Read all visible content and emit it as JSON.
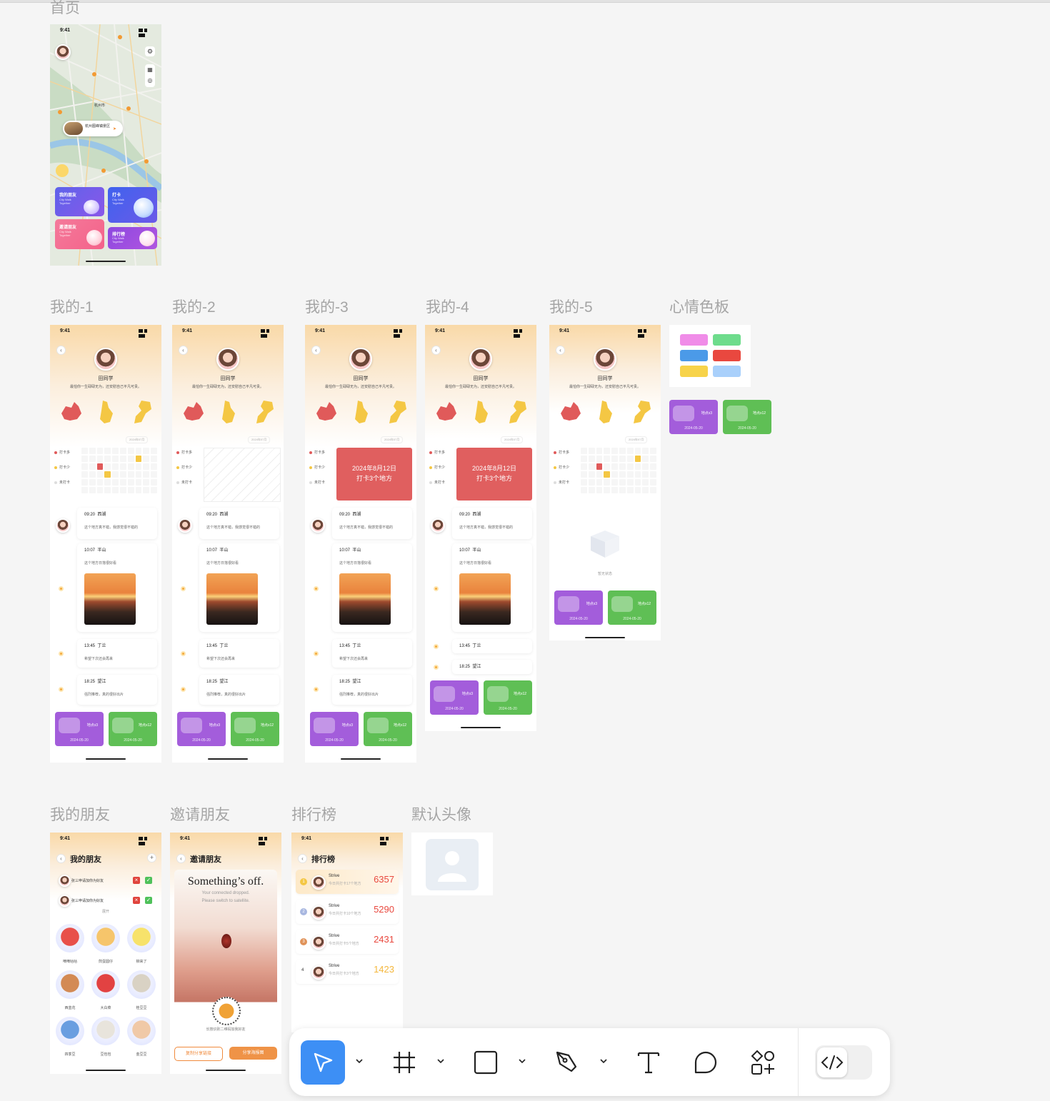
{
  "sections": {
    "home": "首页",
    "me1": "我的-1",
    "me2": "我的-2",
    "me3": "我的-3",
    "me4": "我的-4",
    "me5": "我的-5",
    "mood": "心情色板",
    "friends": "我的朋友",
    "invite": "邀请朋友",
    "rank": "排行榜",
    "default_avatar": "默认头像"
  },
  "status_time": "9:41",
  "home": {
    "city_label": "杭州市",
    "place_label": "杭州图峰镇景区",
    "cards": [
      {
        "title": "我的朋友",
        "sub": "City Walk Together",
        "color": "#6a55e6"
      },
      {
        "title": "打卡",
        "sub": "City Walk Together",
        "color": "#4e6cf0"
      },
      {
        "title": "邀请朋友",
        "sub": "City Walk Together",
        "color": "#f26a8e"
      },
      {
        "title": "排行榜",
        "sub": "City Walk Together",
        "color": "#8a45d9"
      }
    ]
  },
  "profile": {
    "name": "田同学",
    "motto": "最怕你一生碌碌无为，还安慰自己平凡可贵。",
    "date_pill": "2024年07月",
    "legend": [
      "打卡多",
      "打卡少",
      "未打卡"
    ],
    "summary": "2024年8月12日\n打卡3个地方",
    "summary_line1": "2024年8月12日",
    "summary_line2": "打卡3个地方",
    "timeline": [
      {
        "time": "09:20",
        "place": "西湖",
        "text": "这个地方真不错，我感觉很不错的"
      },
      {
        "time": "10:07",
        "place": "半山",
        "text": "这个地方日落很好看"
      },
      {
        "time": "13:45",
        "place": "丁兰",
        "text": "希望下次还会再来"
      },
      {
        "time": "18:25",
        "place": "望江",
        "text": "强烈推荐，真的很好出片"
      }
    ],
    "badges": [
      {
        "label": "地点x3",
        "date": "2024-05-20"
      },
      {
        "label": "地点x12",
        "date": "2024-05-20"
      }
    ],
    "empty_state": "暂无状态"
  },
  "mood_colors": [
    "#f08ce8",
    "#6edc8c",
    "#4b9ae8",
    "#e9483f",
    "#f7d34a",
    "#a9d0fb"
  ],
  "friends": {
    "title": "我的朋友",
    "requests": [
      "张三申请加你为好友",
      "张三申请加你为好友"
    ],
    "expand": "展开",
    "list": [
      "嘀嘀咕咕",
      "煎蛋圆仔",
      "柳来了",
      "西蓝花",
      "大白菜",
      "桂豆豆",
      "四季豆",
      "豆包包",
      "金豆豆"
    ]
  },
  "invite": {
    "title": "邀请朋友",
    "error_title": "Something’s off.",
    "error_sub1": "Your connected dropped.",
    "error_sub2": "Please switch to satellite.",
    "qr_hint": "长按识别二维码加我好友",
    "btn_copy": "复制分享链接",
    "btn_share": "分享海报图"
  },
  "rank": {
    "title": "排行榜",
    "rows": [
      {
        "pos": "1",
        "name": "Strive",
        "sub": "今日共打卡17个地方",
        "score": "6357",
        "color": "#e9493f"
      },
      {
        "pos": "2",
        "name": "Strive",
        "sub": "今日共打卡10个地方",
        "score": "5290",
        "color": "#e9493f"
      },
      {
        "pos": "3",
        "name": "Strive",
        "sub": "今日共打卡5个地方",
        "score": "2431",
        "color": "#e9493f"
      },
      {
        "pos": "4",
        "name": "Strive",
        "sub": "今日共打卡3个地方",
        "score": "1423",
        "color": "#f4b73d"
      }
    ]
  },
  "toolbar": {
    "tools": [
      "move-tool",
      "frame-tool",
      "rectangle-tool",
      "pen-tool",
      "text-tool",
      "comment-tool",
      "assets-tool",
      "dev-mode-toggle"
    ],
    "accent": "#3d8ff5"
  }
}
